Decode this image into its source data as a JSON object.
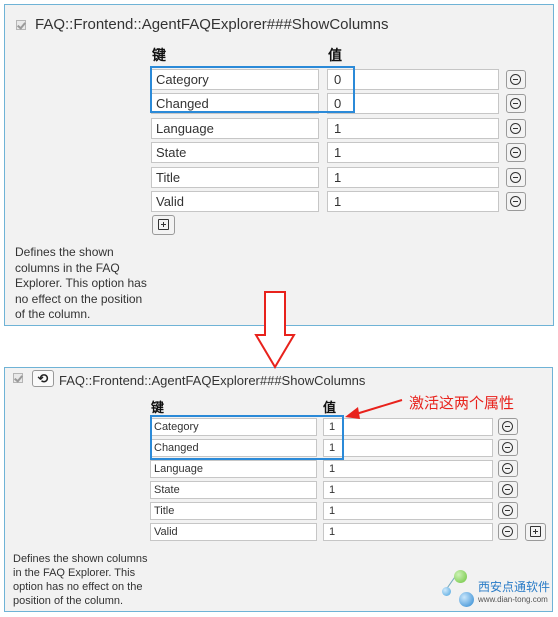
{
  "panel_before": {
    "title": "FAQ::Frontend::AgentFAQExplorer###ShowColumns",
    "key_header": "键",
    "value_header": "值",
    "rows": [
      {
        "key": "Category",
        "value": "0"
      },
      {
        "key": "Changed",
        "value": "0"
      },
      {
        "key": "Language",
        "value": "1"
      },
      {
        "key": "State",
        "value": "1"
      },
      {
        "key": "Title",
        "value": "1"
      },
      {
        "key": "Valid",
        "value": "1"
      }
    ],
    "description": "Defines the shown columns in the FAQ Explorer. This option has no effect on the position of the column."
  },
  "panel_after": {
    "title": "FAQ::Frontend::AgentFAQExplorer###ShowColumns",
    "reset_glyph": "⟲",
    "key_header": "键",
    "value_header": "值",
    "rows": [
      {
        "key": "Category",
        "value": "1"
      },
      {
        "key": "Changed",
        "value": "1"
      },
      {
        "key": "Language",
        "value": "1"
      },
      {
        "key": "State",
        "value": "1"
      },
      {
        "key": "Title",
        "value": "1"
      },
      {
        "key": "Valid",
        "value": "1"
      }
    ],
    "description": "Defines the shown columns in the FAQ Explorer. This option has no effect on the position of the column."
  },
  "annotation": "激活这两个属性",
  "watermark": {
    "name": "西安点通软件",
    "url": "www.dian-tong.com"
  },
  "colors": {
    "highlight": "#2b8ad8",
    "arrow": "#e8221c",
    "panel_border": "#6fb3d6"
  }
}
